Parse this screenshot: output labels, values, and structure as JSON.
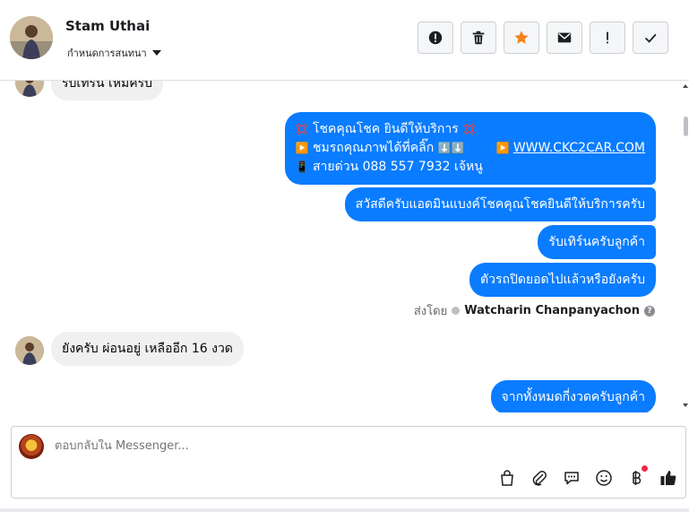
{
  "header": {
    "contact_name": "Stam Uthai",
    "label_dropdown": "กำหนดการสนทนา",
    "actions": [
      {
        "name": "report-button",
        "icon": "alert-circle-icon"
      },
      {
        "name": "delete-button",
        "icon": "trash-icon"
      },
      {
        "name": "star-button",
        "icon": "star-icon"
      },
      {
        "name": "mail-button",
        "icon": "envelope-icon"
      },
      {
        "name": "mark-important-button",
        "icon": "exclamation-icon"
      },
      {
        "name": "mark-done-button",
        "icon": "check-icon"
      }
    ]
  },
  "messages": {
    "in_prev_partial": "รับเทิร์น เหมครับ",
    "out_1_line1_text": "โชคคุณโชค ยินดีให้บริการ",
    "out_1_line2_text": "ชมรถคุณภาพได้ที่คลิ๊ก",
    "out_1_link": "WWW.CKC2CAR.COM",
    "out_1_line3": "สายด่วน 088 557 7932 เจ้หนู",
    "out_2": "สวัสดีครับแอดมินแบงค์โชคคุณโชคยินดีให้บริการครับ",
    "out_3": "รับเทิร์นครับลูกค้า",
    "out_4": "ตัวรถปิดยอดไปแล้วหรือยังครับ",
    "sent_by_label": "ส่งโดย",
    "sent_by_name": "Watcharin Chanpanyachon",
    "in_1": "ยังครับ ผ่อนอยู่ เหลืออีก 16 งวด",
    "out_5": "จากทั้งหมดกี่งวดครับลูกค้า"
  },
  "composer": {
    "placeholder": "ตอบกลับใน Messenger..."
  },
  "colors": {
    "outgoing_bubble": "#0a7cff",
    "incoming_bubble": "#f0f0f0",
    "star_accent": "#f5821f",
    "notification_dot": "#f02849"
  }
}
